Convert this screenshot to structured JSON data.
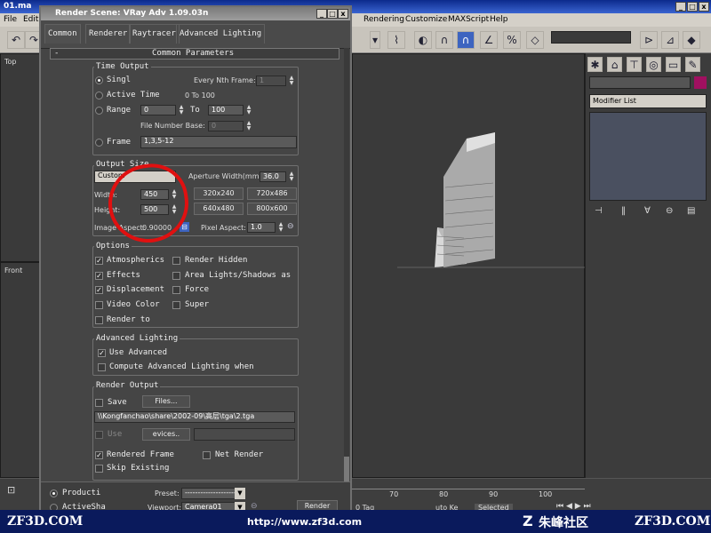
{
  "max": {
    "window_title": "01.ma",
    "menu": {
      "file": "File",
      "edit": "Edit",
      "rendering": "Rendering",
      "customize": "Customize",
      "maxscript": "MAXScript",
      "help": "Help"
    },
    "viewport_top": "Top",
    "viewport_front": "Front",
    "modifier_list": "Modifier List",
    "timeline_ticks": [
      "70",
      "80",
      "90",
      "100"
    ],
    "status": {
      "selected": "Selected",
      "autokey": "uto Ke",
      "add_time": "0 Tag"
    },
    "win_controls": {
      "min": "_",
      "max": "□",
      "close": "x"
    }
  },
  "dialog": {
    "title": "Render Scene: VRay Adv 1.09.03n",
    "win_controls": {
      "min": "_",
      "max": "□",
      "close": "x"
    },
    "tabs": [
      "Common",
      "Renderer",
      "Raytracer",
      "Advanced Lighting"
    ],
    "rollout_title": "Common Parameters",
    "rollout_toggle": "-",
    "time_output": {
      "label": "Time Output",
      "single": "Singl",
      "every_nth": "Every Nth Frame:",
      "every_nth_value": "1",
      "active_time": "Active Time",
      "active_range": "0 To 100",
      "range": "Range",
      "range_from": "0",
      "range_to_label": "To",
      "range_to": "100",
      "file_number_base": "File Number Base:",
      "file_number_base_value": "0",
      "frame": "Frame",
      "frame_value": "1,3,5-12"
    },
    "output_size": {
      "label": "Output Size",
      "preset": "Custom",
      "aperture_label": "Aperture Width(mm):",
      "aperture_value": "36.0",
      "width_label": "Width:",
      "width_value": "450",
      "height_label": "Height:",
      "height_value": "500",
      "presets": [
        "320x240",
        "720x486",
        "640x480",
        "800x600"
      ],
      "image_aspect_label": "Image Aspect:",
      "image_aspect_value": "0.90000",
      "pixel_aspect_label": "Pixel Aspect:",
      "pixel_aspect_value": "1.0"
    },
    "options": {
      "label": "Options",
      "atmospherics": "Atmospherics",
      "render_hidden": "Render Hidden",
      "effects": "Effects",
      "area_lights": "Area Lights/Shadows as",
      "displacement": "Displacement",
      "force": "Force",
      "video_color": "Video Color",
      "super": "Super",
      "render_to": "Render to"
    },
    "advanced_lighting": {
      "label": "Advanced Lighting",
      "use_advanced": "Use Advanced",
      "compute": "Compute Advanced Lighting when"
    },
    "render_output": {
      "label": "Render Output",
      "save": "Save",
      "files_button": "Files...",
      "path": "\\\\Kongfanchao\\share\\2002-09\\高层\\tga\\2.tga",
      "use_device": "Use",
      "devices_button": "evices..",
      "rendered_frame": "Rendered Frame",
      "net_render": "Net Render",
      "skip_existing": "Skip Existing"
    },
    "footer": {
      "production": "Producti",
      "activeshade": "ActiveSha",
      "preset_label": "Preset:",
      "preset_value": "--------------------",
      "viewport_label": "Viewport:",
      "viewport_value": "Camera01",
      "render_button": "Render"
    }
  },
  "banner": {
    "left": "ZF3D.COM",
    "url": "http://www.zf3d.com",
    "logo_text": "朱峰社区",
    "right": "ZF3D.COM"
  },
  "colors": {
    "annotation": "#e01010",
    "title_active": "#0c2a8c",
    "dialog_bg": "#454545"
  }
}
